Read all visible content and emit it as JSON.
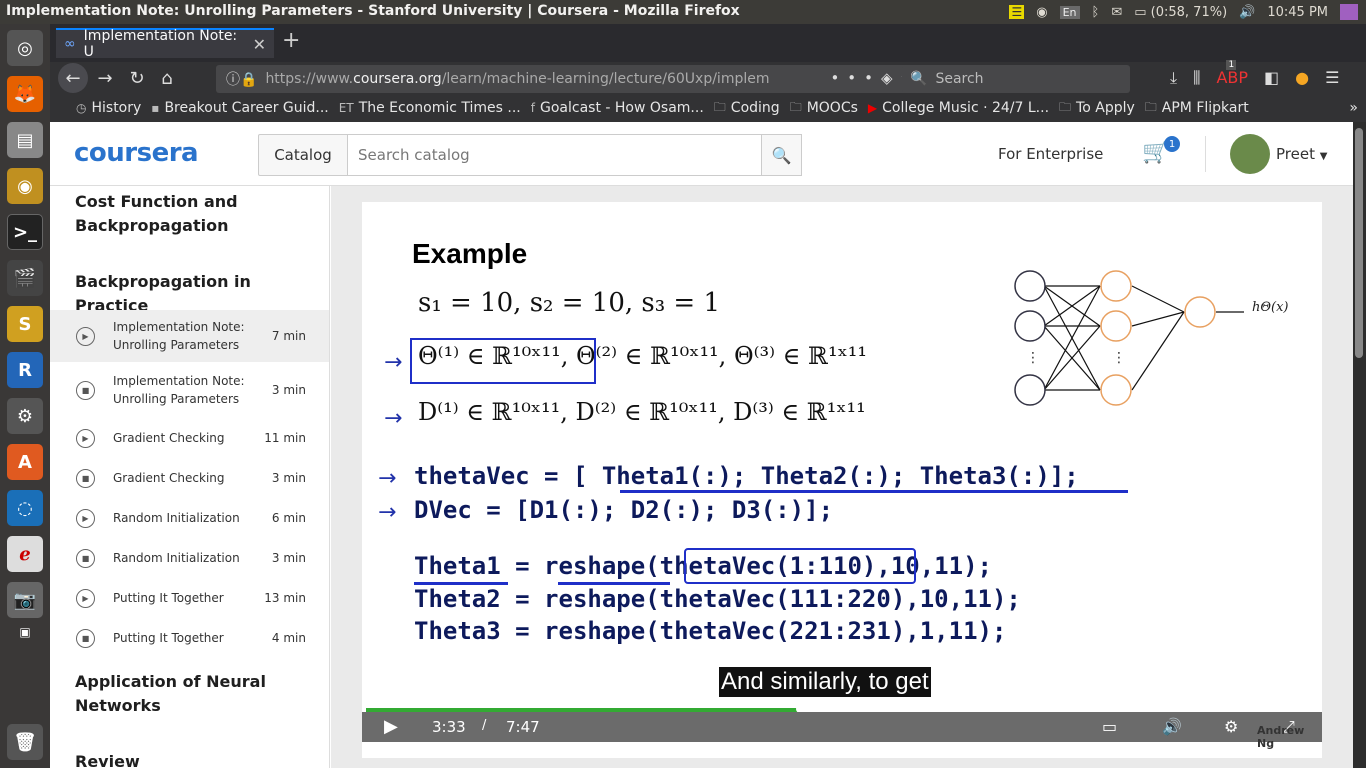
{
  "system": {
    "window_title": "Implementation Note: Unrolling Parameters - Stanford University | Coursera - Mozilla Firefox",
    "lang": "En",
    "battery": "(0:58, 71%)",
    "clock": "10:45 PM"
  },
  "browser": {
    "tab_title": "Implementation Note: U",
    "url_prefix": "https://www.",
    "url_domain": "coursera.org",
    "url_path": "/learn/machine-learning/lecture/60Uxp/implem",
    "search_placeholder": "Search",
    "bookmarks": [
      {
        "label": "History",
        "icon": "history-icon"
      },
      {
        "label": "Breakout Career Guid...",
        "icon": "page-icon"
      },
      {
        "label": "The Economic Times ...",
        "icon": "et-icon",
        "badge": "ET"
      },
      {
        "label": "Goalcast - How Osam...",
        "icon": "facebook-icon",
        "badge": "f"
      },
      {
        "label": "Coding",
        "icon": "folder-icon"
      },
      {
        "label": "MOOCs",
        "icon": "folder-icon"
      },
      {
        "label": "College Music · 24/7 L...",
        "icon": "youtube-icon"
      },
      {
        "label": "To Apply",
        "icon": "folder-icon"
      },
      {
        "label": "APM Flipkart",
        "icon": "folder-icon"
      }
    ],
    "abp_count": "1"
  },
  "header": {
    "logo": "coursera",
    "catalog_label": "Catalog",
    "search_placeholder": "Search catalog",
    "enterprise_label": "For Enterprise",
    "cart_count": "1",
    "user_name": "Preet"
  },
  "sidebar": {
    "section1": "Cost Function and Backpropagation",
    "section2": "Backpropagation in Practice",
    "items": [
      {
        "title": "Implementation Note: Unrolling Parameters",
        "duration": "7 min",
        "type": "video",
        "selected": true
      },
      {
        "title": "Implementation Note: Unrolling Parameters",
        "duration": "3 min",
        "type": "reading"
      },
      {
        "title": "Gradient Checking",
        "duration": "11 min",
        "type": "video"
      },
      {
        "title": "Gradient Checking",
        "duration": "3 min",
        "type": "reading"
      },
      {
        "title": "Random Initialization",
        "duration": "6 min",
        "type": "video"
      },
      {
        "title": "Random Initialization",
        "duration": "3 min",
        "type": "reading"
      },
      {
        "title": "Putting It Together",
        "duration": "13 min",
        "type": "video"
      },
      {
        "title": "Putting It Together",
        "duration": "4 min",
        "type": "reading"
      }
    ],
    "section3": "Application of Neural Networks",
    "section4": "Review"
  },
  "video": {
    "slide_title": "Example",
    "line_s": "s₁ = 10, s₂ = 10, s₃ = 1",
    "line_theta": "Θ⁽¹⁾ ∈ ℝ¹⁰ˣ¹¹, Θ⁽²⁾ ∈ ℝ¹⁰ˣ¹¹, Θ⁽³⁾ ∈ ℝ¹ˣ¹¹",
    "line_d": "D⁽¹⁾ ∈ ℝ¹⁰ˣ¹¹, D⁽²⁾ ∈ ℝ¹⁰ˣ¹¹, D⁽³⁾ ∈ ℝ¹ˣ¹¹",
    "code1": "thetaVec = [ Theta1(:); Theta2(:); Theta3(:)];",
    "code2": "DVec = [D1(:); D2(:); D3(:)];",
    "code3": "Theta1 = reshape(thetaVec(1:110),10,11);",
    "code4": "Theta2 = reshape(thetaVec(111:220),10,11);",
    "code5": "Theta3 = reshape(thetaVec(221:231),1,11);",
    "nn_output": "hΘ(x)",
    "caption": "And similarly, to get",
    "current_time": "3:33",
    "separator": "/",
    "duration": "7:47",
    "progress": 0.456,
    "presenter": "Andrew Ng"
  }
}
